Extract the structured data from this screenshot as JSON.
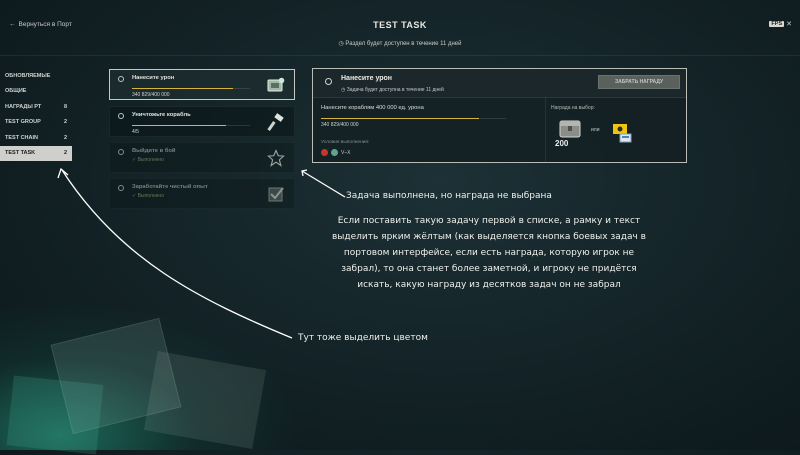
{
  "header": {
    "back_label": "Вернуться в Порт",
    "title": "TEST TASK",
    "availability": "Раздел будет доступен в течение 11 дней",
    "fps_badge": "FPS"
  },
  "sidebar": {
    "items": [
      {
        "label": "ОБНОВЛЯЕМЫЕ",
        "count": ""
      },
      {
        "label": "ОБЩИЕ",
        "count": ""
      },
      {
        "label": "НАГРАДЫ РТ",
        "count": "8"
      },
      {
        "label": "TEST GROUP",
        "count": "2"
      },
      {
        "label": "TEST CHAIN",
        "count": "2"
      },
      {
        "label": "TEST TASK",
        "count": "2"
      }
    ]
  },
  "tasks": [
    {
      "name": "Нанесите урон",
      "progress_text": "340 829/400 000",
      "progress": 0.852,
      "icon": "damage-reward-icon"
    },
    {
      "name": "Уничтожьте корабль",
      "progress_text": "4/5",
      "progress": 0.8,
      "icon": "hammer-icon"
    },
    {
      "name": "Выйдите в бой",
      "status": "Выполнено",
      "icon": "star-icon"
    },
    {
      "name": "Заработайте чистый опыт",
      "status": "Выполнено",
      "icon": "check-box-icon"
    }
  ],
  "detail": {
    "title": "Нанесите урон",
    "availability": "Задача будет доступна в течение 11 дней",
    "claim_button": "ЗАБРАТЬ НАГРАДУ",
    "condition": "Нанесите кораблям 400 000 ед. урона",
    "progress_text": "340 829/400 000",
    "progress": 0.852,
    "conditions_label": "Условия выполнения:",
    "tier_range": "V–X",
    "reward_label": "Награда на выбор:",
    "reward_amount": "200",
    "or_label": "или"
  },
  "annotations": {
    "note1": "Задача выполнена, но награда не выбрана",
    "note2": "Если поставить такую задачу первой в списке, а рамку и текст выделить ярким жёлтым (как выделяется кнопка боевых задач в портовом интерфейсе, если есть награда, которую игрок не забрал), то она станет более заметной, и игроку не придётся искать, какую награду из десятков задач он не забрал",
    "note3": "Тут тоже выделить цветом"
  },
  "colors": {
    "accent_progress": "#d7b53c",
    "done_status": "#8fa36a",
    "active_sidebar_bg": "#cfd0cb"
  }
}
